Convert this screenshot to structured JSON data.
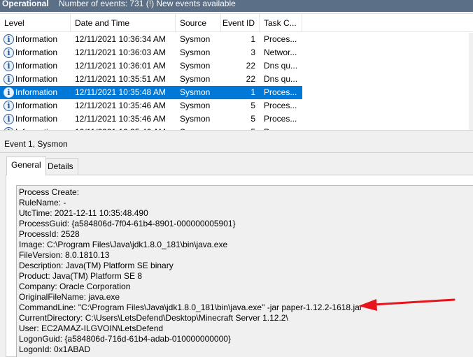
{
  "window": {
    "log_name": "Operational",
    "event_count_text": "Number of events: 731 (!) New events available"
  },
  "grid": {
    "columns": [
      "Level",
      "Date and Time",
      "Source",
      "Event ID",
      "Task C..."
    ],
    "rows": [
      {
        "level": "Information",
        "datetime": "12/11/2021 10:36:34 AM",
        "source": "Sysmon",
        "event_id": "1",
        "task": "Proces..."
      },
      {
        "level": "Information",
        "datetime": "12/11/2021 10:36:03 AM",
        "source": "Sysmon",
        "event_id": "3",
        "task": "Networ..."
      },
      {
        "level": "Information",
        "datetime": "12/11/2021 10:36:01 AM",
        "source": "Sysmon",
        "event_id": "22",
        "task": "Dns qu..."
      },
      {
        "level": "Information",
        "datetime": "12/11/2021 10:35:51 AM",
        "source": "Sysmon",
        "event_id": "22",
        "task": "Dns qu..."
      },
      {
        "level": "Information",
        "datetime": "12/11/2021 10:35:48 AM",
        "source": "Sysmon",
        "event_id": "1",
        "task": "Proces...",
        "selected": true
      },
      {
        "level": "Information",
        "datetime": "12/11/2021 10:35:46 AM",
        "source": "Sysmon",
        "event_id": "5",
        "task": "Proces..."
      },
      {
        "level": "Information",
        "datetime": "12/11/2021 10:35:46 AM",
        "source": "Sysmon",
        "event_id": "5",
        "task": "Proces..."
      },
      {
        "level": "Information",
        "datetime": "12/11/2021 10:35:46 AM",
        "source": "Sysmon",
        "event_id": "5",
        "task": "Proces..."
      }
    ]
  },
  "detail": {
    "title": "Event 1, Sysmon",
    "tabs": [
      "General",
      "Details"
    ],
    "active_tab": "General",
    "lines": [
      "Process Create:",
      "RuleName: -",
      "UtcTime: 2021-12-11 10:35:48.490",
      "ProcessGuid: {a584806d-7f04-61b4-8901-000000005901}",
      "ProcessId: 2528",
      "Image: C:\\Program Files\\Java\\jdk1.8.0_181\\bin\\java.exe",
      "FileVersion: 8.0.1810.13",
      "Description: Java(TM) Platform SE binary",
      "Product: Java(TM) Platform SE 8",
      "Company: Oracle Corporation",
      "OriginalFileName: java.exe",
      "CommandLine: \"C:\\Program Files\\Java\\jdk1.8.0_181\\bin\\java.exe\"  -jar paper-1.12.2-1618.jar",
      "CurrentDirectory: C:\\Users\\LetsDefend\\Desktop\\Minecraft Server 1.12.2\\",
      "User: EC2AMAZ-ILGVOIN\\LetsDefend",
      "LogonGuid: {a584806d-716d-61b4-adab-010000000000}",
      "LogonId: 0x1ABAD"
    ]
  },
  "colors": {
    "selection": "#0078d7",
    "annotation_arrow": "#e8141c"
  },
  "icons": {
    "level": "information-icon",
    "annotation": "red-arrow-annotation"
  }
}
